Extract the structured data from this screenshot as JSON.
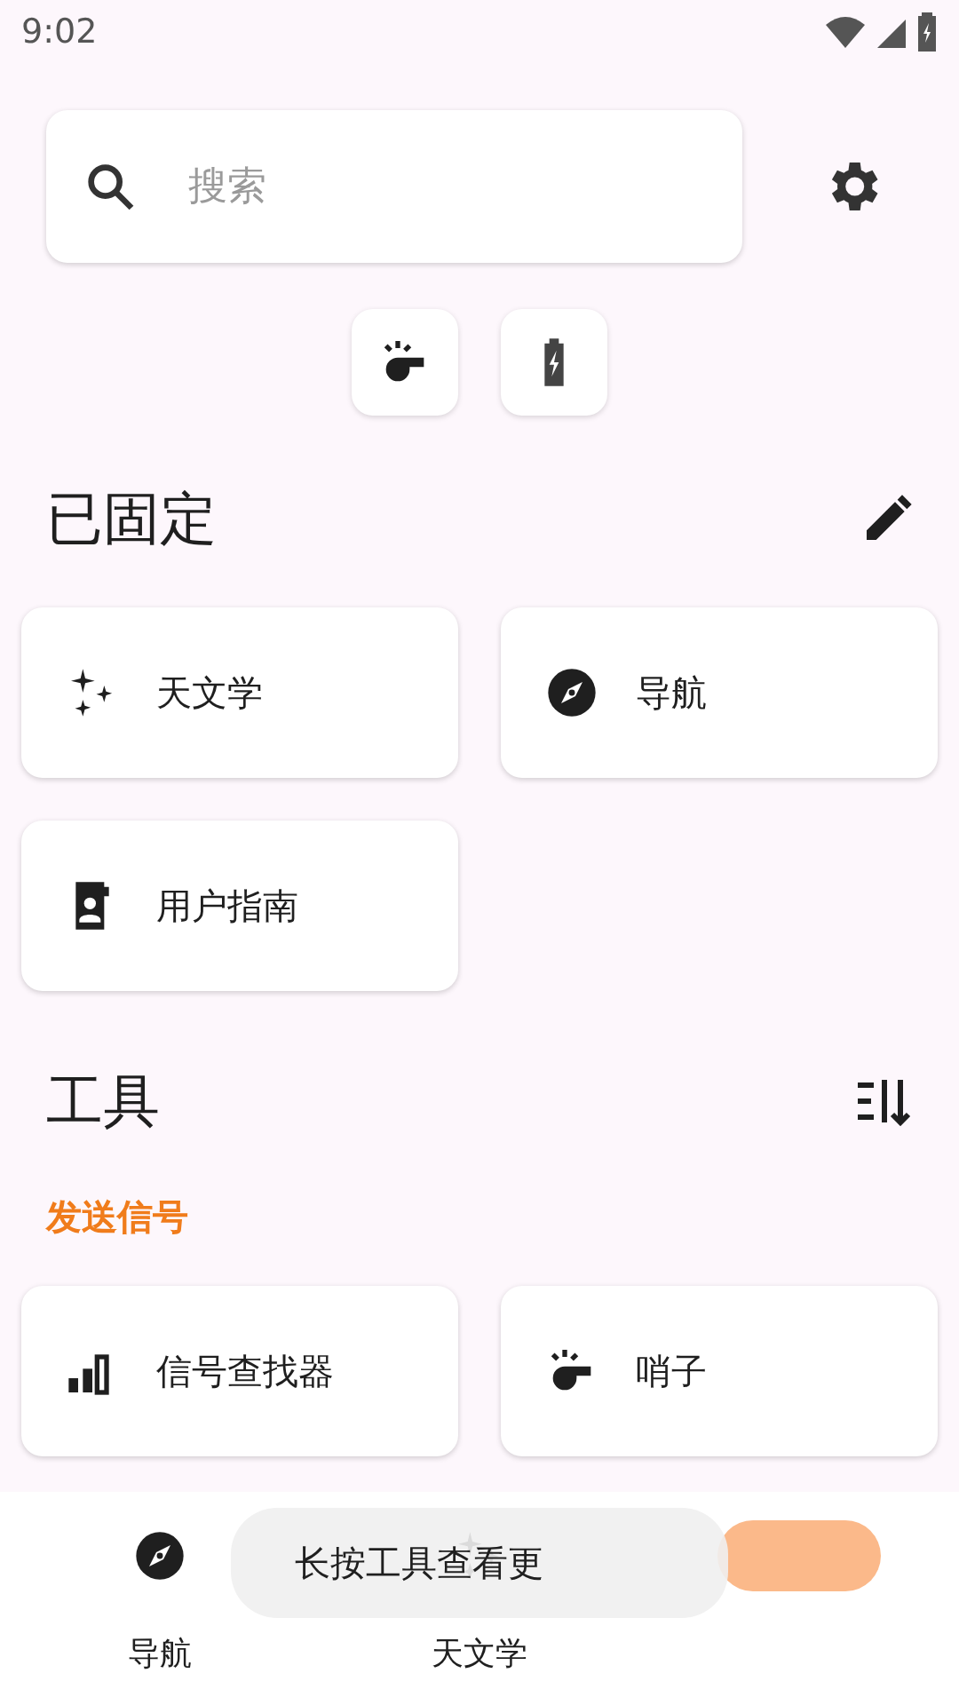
{
  "status_bar": {
    "time": "9:02"
  },
  "search": {
    "placeholder": "搜索"
  },
  "quick_actions": [
    {
      "kind": "whistle"
    },
    {
      "kind": "battery"
    }
  ],
  "pinned": {
    "title": "已固定",
    "items": [
      {
        "label": "天文学",
        "kind": "sparkles"
      },
      {
        "label": "导航",
        "kind": "compass"
      },
      {
        "label": "用户指南",
        "kind": "guide"
      }
    ]
  },
  "tools": {
    "title": "工具",
    "sections": [
      {
        "title": "发送信号",
        "items": [
          {
            "label": "信号查找器",
            "kind": "signal"
          },
          {
            "label": "哨子",
            "kind": "whistle"
          }
        ]
      }
    ]
  },
  "bottom_nav": [
    {
      "label": "导航",
      "kind": "compass",
      "selected": false
    },
    {
      "label": "天文学",
      "kind": "sparkles",
      "selected": false
    },
    {
      "selected": true
    }
  ],
  "snackbar": {
    "text": "长按工具查看更"
  }
}
